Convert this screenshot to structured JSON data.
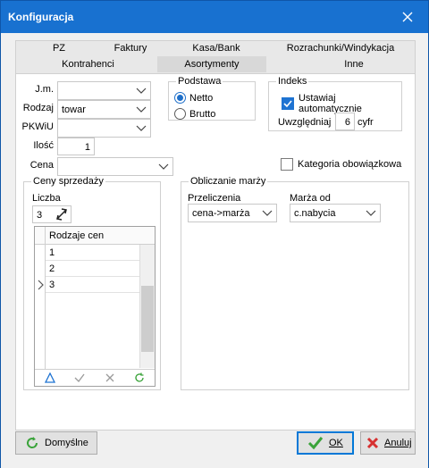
{
  "window": {
    "title": "Konfiguracja"
  },
  "tabs": {
    "top": [
      "PZ",
      "Faktury",
      "Kasa/Bank",
      "Rozrachunki/Windykacja"
    ],
    "bottom": [
      "Kontrahenci",
      "Asortymenty",
      "Inne"
    ],
    "active": "Asortymenty"
  },
  "form": {
    "jm_label": "J.m.",
    "jm_value": "",
    "rodzaj_label": "Rodzaj",
    "rodzaj_value": "towar",
    "pkwiu_label": "PKWiU",
    "pkwiu_value": "",
    "ilosc_label": "Ilość",
    "ilosc_value": "1",
    "cena_label": "Cena",
    "cena_value": ""
  },
  "podstawa": {
    "legend": "Podstawa",
    "netto": "Netto",
    "brutto": "Brutto",
    "selected": "Netto"
  },
  "indeks": {
    "legend": "Indeks",
    "auto_label": "Ustawiaj automatycznie",
    "auto_checked": true,
    "uwzgl_label": "Uwzględniaj",
    "uwzgl_value": "6",
    "uwzgl_suffix": "cyfr"
  },
  "kategoria": {
    "label": "Kategoria obowiązkowa",
    "checked": false
  },
  "ceny": {
    "legend": "Ceny sprzedaży",
    "liczba_label": "Liczba",
    "liczba_value": "3",
    "grid_header": "Rodzaje cen",
    "rows": [
      "1",
      "2",
      "3"
    ]
  },
  "marza": {
    "legend": "Obliczanie marży",
    "przel_label": "Przeliczenia",
    "przel_value": "cena->marża",
    "marza_od_label": "Marża od",
    "marza_od_value": "c.nabycia"
  },
  "buttons": {
    "domyslne": "Domyślne",
    "ok": "OK",
    "anuluj": "Anuluj"
  },
  "colors": {
    "titlebar": "#1871d0",
    "accent": "#1e73d2",
    "ok_green": "#3aa33a",
    "cancel_red": "#d63131"
  }
}
